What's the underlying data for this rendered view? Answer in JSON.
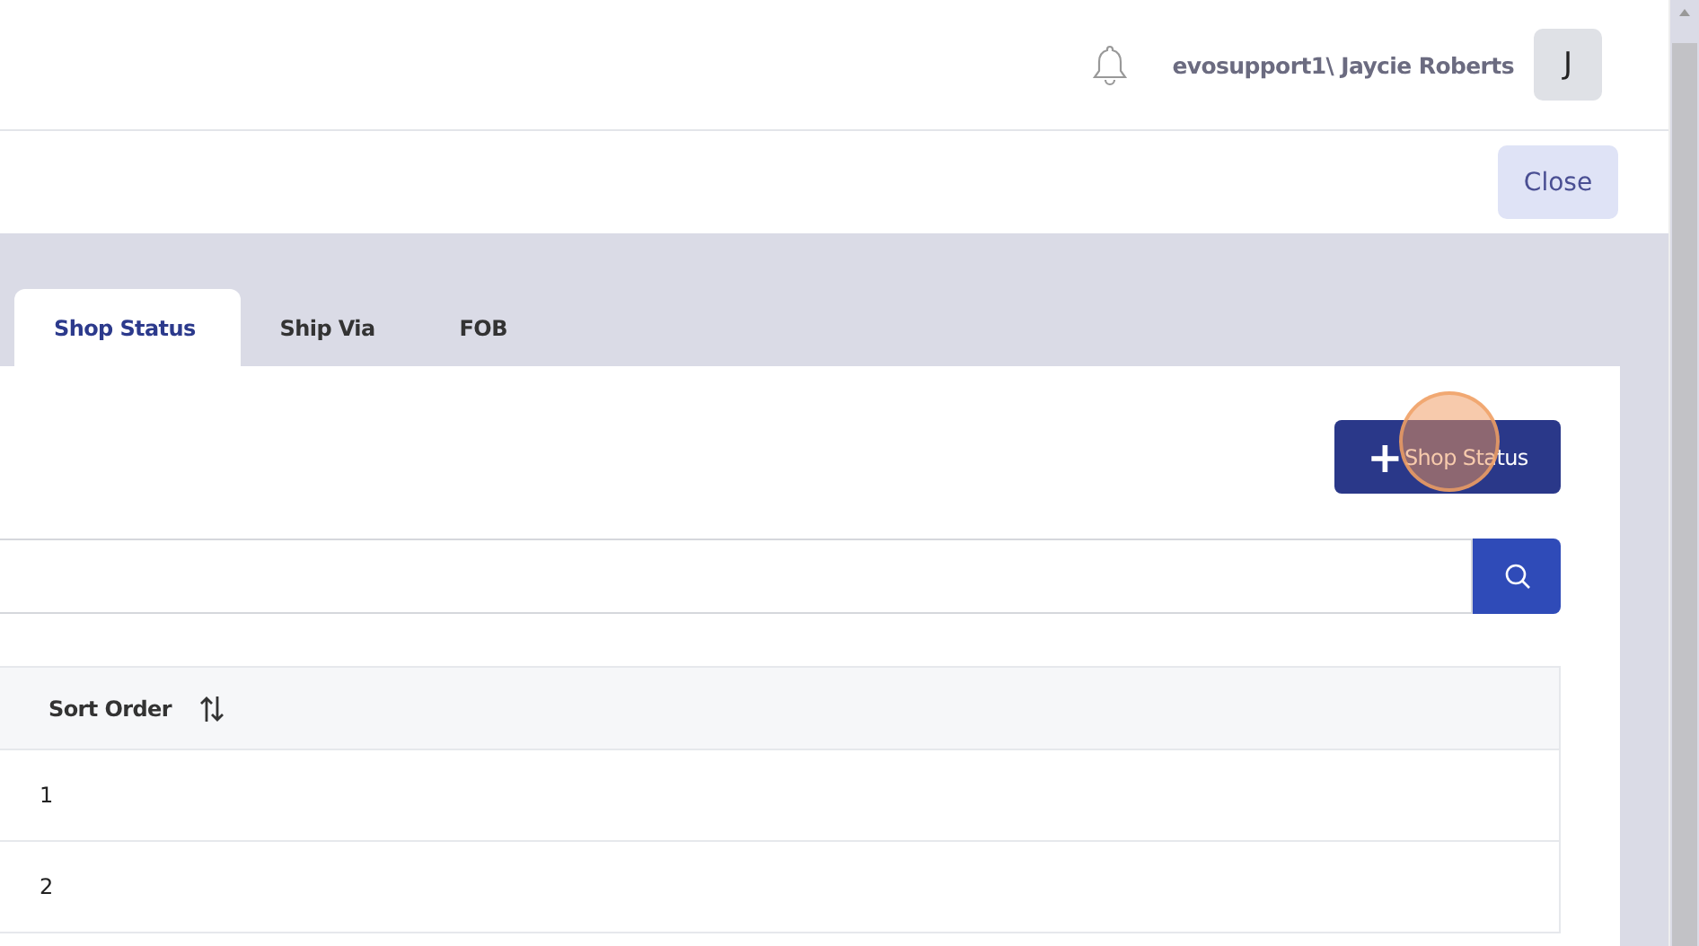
{
  "header": {
    "user": "evosupport1\\ Jaycie Roberts",
    "avatar": "J"
  },
  "toolbar": {
    "close": "Close"
  },
  "tabs": [
    {
      "label": "Shop Status",
      "selected": true
    },
    {
      "label": "Ship Via",
      "selected": false
    },
    {
      "label": "FOB",
      "selected": false
    }
  ],
  "add_button": {
    "icon": "+",
    "label": "Shop Status"
  },
  "table": {
    "columns": [
      "Sort Order"
    ],
    "rows": [
      [
        "1"
      ],
      [
        "2"
      ]
    ]
  }
}
